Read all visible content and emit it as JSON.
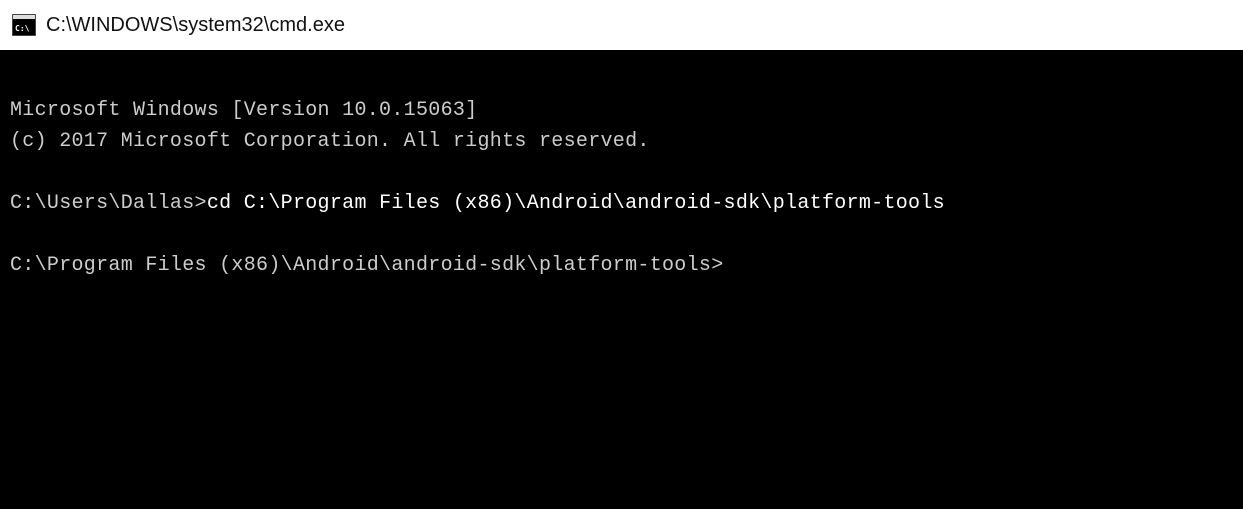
{
  "window": {
    "title": "C:\\WINDOWS\\system32\\cmd.exe"
  },
  "terminal": {
    "banner_line1": "Microsoft Windows [Version 10.0.15063]",
    "banner_line2": "(c) 2017 Microsoft Corporation. All rights reserved.",
    "lines": [
      {
        "prompt": "C:\\Users\\Dallas>",
        "command": "cd C:\\Program Files (x86)\\Android\\android-sdk\\platform-tools"
      },
      {
        "prompt": "C:\\Program Files (x86)\\Android\\android-sdk\\platform-tools>",
        "command": ""
      }
    ]
  }
}
